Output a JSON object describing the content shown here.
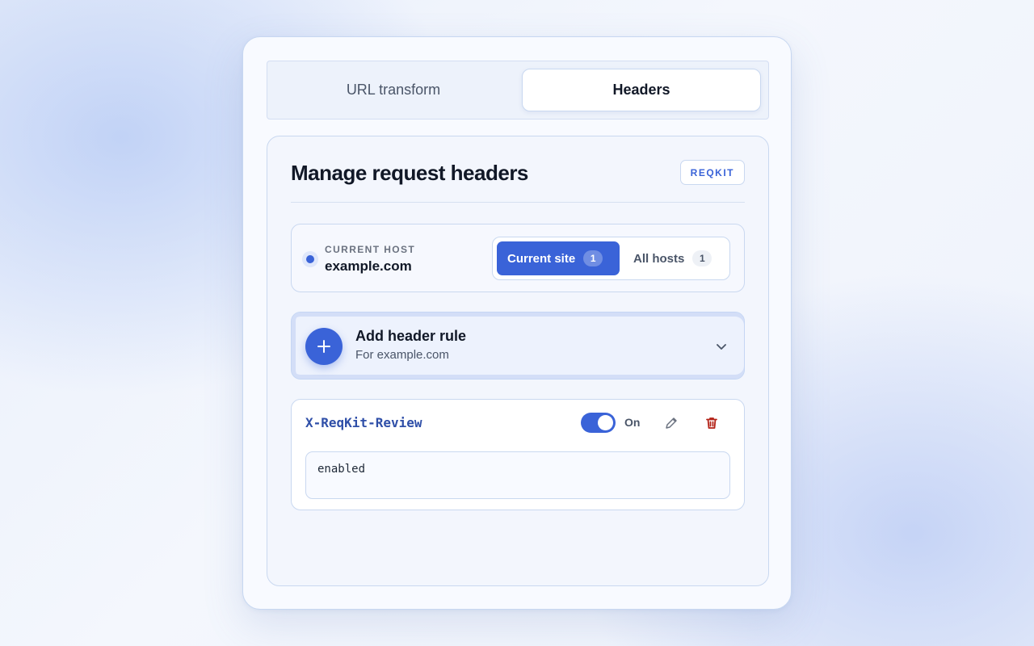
{
  "tabs": [
    {
      "label": "URL transform",
      "active": false
    },
    {
      "label": "Headers",
      "active": true
    }
  ],
  "panel": {
    "title": "Manage request headers",
    "brand": "REQKIT"
  },
  "host": {
    "label": "CURRENT HOST",
    "value": "example.com",
    "scope": {
      "current_site": {
        "label": "Current site",
        "count": "1",
        "active": true
      },
      "all_hosts": {
        "label": "All hosts",
        "count": "1",
        "active": false
      }
    }
  },
  "add_rule": {
    "title": "Add header rule",
    "subtitle": "For example.com",
    "icon": "plus-icon"
  },
  "rules": [
    {
      "name": "X-ReqKit-Review",
      "enabled": true,
      "toggle_label": "On",
      "value": "enabled"
    }
  ],
  "colors": {
    "accent": "#3a63d8",
    "delete": "#b42318",
    "rule_name": "#2f4fa8"
  }
}
